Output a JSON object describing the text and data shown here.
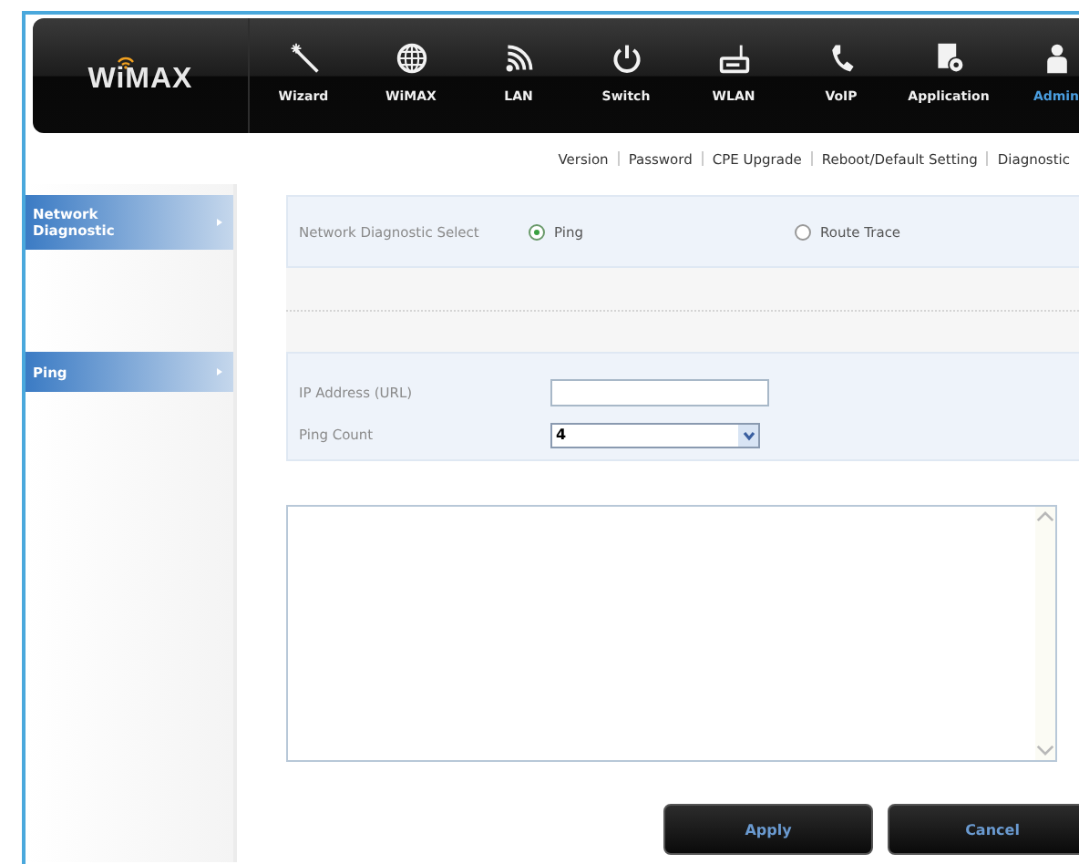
{
  "brand": "WiMAX",
  "nav": [
    {
      "label": "Wizard",
      "selected": false
    },
    {
      "label": "WiMAX",
      "selected": false
    },
    {
      "label": "LAN",
      "selected": false
    },
    {
      "label": "Switch",
      "selected": false
    },
    {
      "label": "WLAN",
      "selected": false
    },
    {
      "label": "VoIP",
      "selected": false
    },
    {
      "label": "Application",
      "selected": false
    },
    {
      "label": "Admin",
      "selected": true
    }
  ],
  "subnav": [
    "Version",
    "Password",
    "CPE Upgrade",
    "Reboot/Default Setting",
    "Diagnostic"
  ],
  "sidebar": {
    "items": [
      "Network Diagnostic",
      "Ping"
    ]
  },
  "mode": {
    "label": "Network Diagnostic Select",
    "options": [
      {
        "label": "Ping",
        "selected": true
      },
      {
        "label": "Route Trace",
        "selected": false
      }
    ]
  },
  "fields": [
    {
      "label": "IP Address (URL)",
      "kind": "text"
    },
    {
      "label": "Ping Count",
      "kind": "select",
      "value": "4"
    }
  ],
  "buttons": [
    "Apply",
    "Cancel"
  ]
}
